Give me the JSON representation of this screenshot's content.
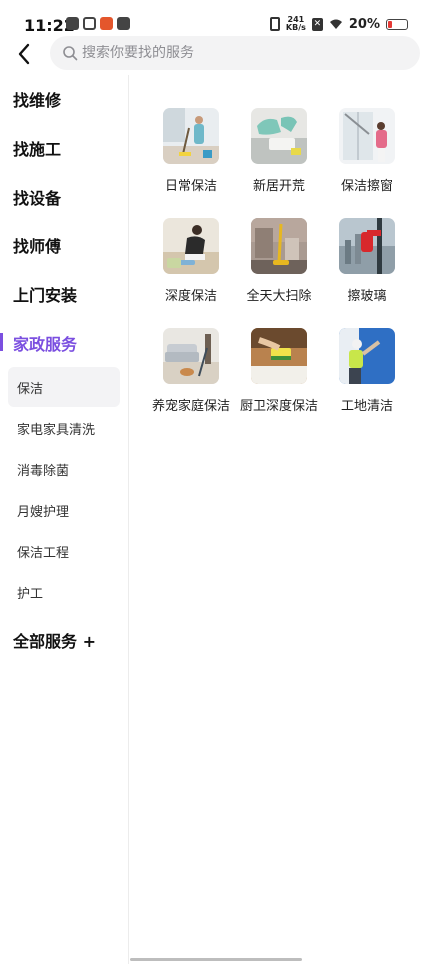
{
  "status_bar": {
    "time": "11:22",
    "net_speed_value": "241",
    "net_speed_unit": "KB/s",
    "battery_percent": "20%"
  },
  "search": {
    "placeholder": "搜索你要找的服务"
  },
  "sidebar": {
    "categories": [
      {
        "label": "找维修"
      },
      {
        "label": "找施工"
      },
      {
        "label": "找设备"
      },
      {
        "label": "找师傅"
      },
      {
        "label": "上门安装"
      },
      {
        "label": "家政服务",
        "active": true
      },
      {
        "label": "全部服务 +"
      }
    ],
    "subcategories": [
      {
        "label": "保洁",
        "active": true
      },
      {
        "label": "家电家具清洗"
      },
      {
        "label": "消毒除菌"
      },
      {
        "label": "月嫂护理"
      },
      {
        "label": "保洁工程"
      },
      {
        "label": "护工"
      }
    ]
  },
  "services": [
    {
      "label": "日常保洁",
      "icon": "mopping-photo"
    },
    {
      "label": "新居开荒",
      "icon": "gloved-hand-cleaning-photo"
    },
    {
      "label": "保洁擦窗",
      "icon": "window-wiping-photo"
    },
    {
      "label": "深度保洁",
      "icon": "floor-scrubbing-photo"
    },
    {
      "label": "全天大扫除",
      "icon": "vacuum-cleaning-photo"
    },
    {
      "label": "擦玻璃",
      "icon": "glass-squeegee-photo"
    },
    {
      "label": "养宠家庭保洁",
      "icon": "pet-living-room-photo"
    },
    {
      "label": "厨卫深度保洁",
      "icon": "sponge-countertop-photo"
    },
    {
      "label": "工地清洁",
      "icon": "worker-wall-cleaning-photo"
    }
  ],
  "colors": {
    "accent": "#7b4fe0",
    "search_bg": "#f3f3f4",
    "active_sub_bg": "#f3f3f5",
    "battery_low": "#e53935"
  }
}
